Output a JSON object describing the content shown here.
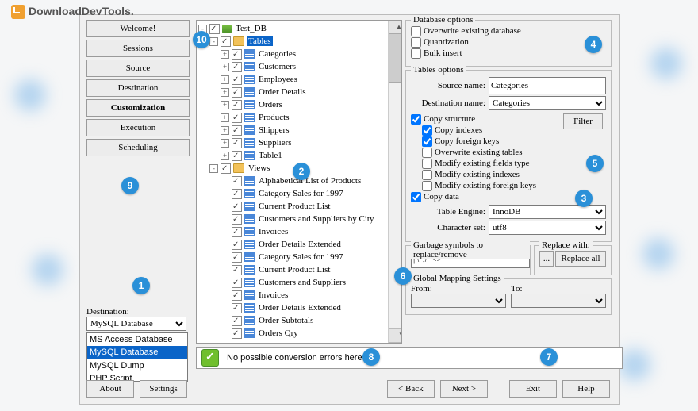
{
  "brand": "DownloadDevTools.",
  "nav": [
    "Welcome!",
    "Sessions",
    "Source",
    "Destination",
    "Customization",
    "Execution",
    "Scheduling"
  ],
  "nav_selected": 4,
  "dest_label": "Destination:",
  "dest_value": "MySQL Database",
  "dest_options": [
    "MS Access Database",
    "MySQL Database",
    "MySQL Dump",
    "PHP Script"
  ],
  "dest_selected": 1,
  "buttons": {
    "about": "About",
    "settings": "Settings",
    "back": "< Back",
    "next": "Next >",
    "exit": "Exit",
    "help": "Help"
  },
  "tree": {
    "root": "Test_DB",
    "tables_label": "Tables",
    "tables": [
      "Categories",
      "Customers",
      "Employees",
      "Order Details",
      "Orders",
      "Products",
      "Shippers",
      "Suppliers",
      "Table1"
    ],
    "views_label": "Views",
    "views": [
      "Alphabetical List of Products",
      "Category Sales for 1997",
      "Current Product List",
      "Customers and Suppliers by City",
      "Invoices",
      "Order Details Extended",
      "Category Sales for 1997",
      "Current Product List",
      "Customers and Suppliers",
      "Invoices",
      "Order Details Extended",
      "Order Subtotals",
      "Orders Qry"
    ]
  },
  "db_opts": {
    "title": "Database options",
    "items": [
      "Overwrite existing database",
      "Quantization",
      "Bulk insert"
    ]
  },
  "tbl_opts": {
    "title": "Tables options",
    "source_label": "Source name:",
    "source_value": "Categories",
    "dest_label": "Destination name:",
    "dest_value": "Categories",
    "copy_structure": "Copy structure",
    "copy_indexes": "Copy indexes",
    "copy_fk": "Copy foreign keys",
    "overwrite": "Overwrite existing tables",
    "mod_fields": "Modify existing fields type",
    "mod_idx": "Modify existing indexes",
    "mod_fk": "Modify existing foreign keys",
    "copy_data": "Copy data",
    "engine_label": "Table Engine:",
    "engine_value": "InnoDB",
    "charset_label": "Character set:",
    "charset_value": "utf8",
    "filter": "Filter"
  },
  "garbage": {
    "title": "Garbage symbols to replace/remove",
    "value": "|'\\\";/*<>",
    "replace_label": "Replace with:",
    "dots": "...",
    "replace_all": "Replace all"
  },
  "mapping": {
    "title": "Global Mapping Settings",
    "from": "From:",
    "to": "To:"
  },
  "status": "No possible conversion errors here.",
  "callouts": {
    "1": "1",
    "2": "2",
    "3": "3",
    "4": "4",
    "5": "5",
    "6": "6",
    "7": "7",
    "8": "8",
    "9": "9",
    "10": "10"
  }
}
